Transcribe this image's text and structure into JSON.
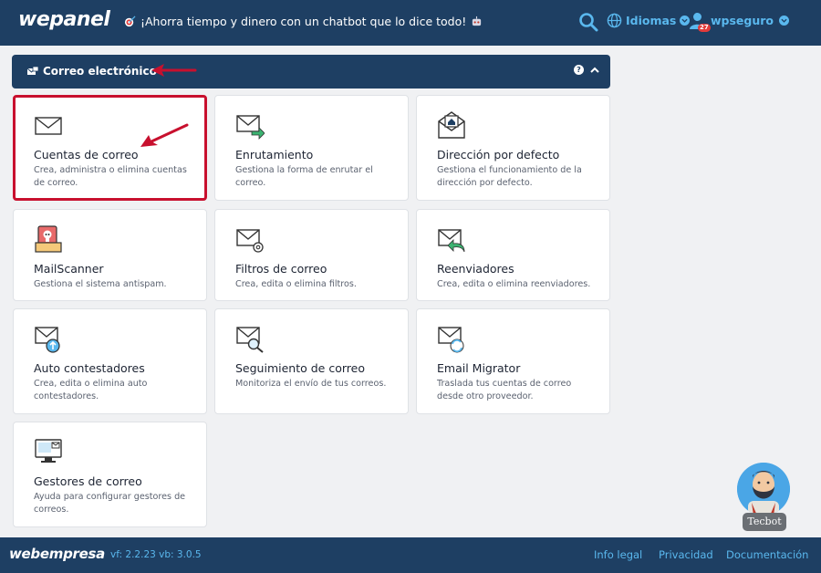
{
  "topbar": {
    "logo": "wepanel",
    "promo_text": "¡Ahorra tiempo y dinero con un chatbot que lo dice todo!",
    "languages_label": "Idiomas",
    "username": "wpseguro",
    "notification_count": "27"
  },
  "section": {
    "title": "Correo electrónico",
    "help_label": "?"
  },
  "cards": [
    {
      "title": "Cuentas de correo",
      "description": "Crea, administra o elimina cuentas de correo.",
      "icon": "mail-envelope-icon"
    },
    {
      "title": "Enrutamiento",
      "description": "Gestiona la forma de enrutar el correo.",
      "icon": "mail-routing-icon"
    },
    {
      "title": "Dirección por defecto",
      "description": "Gestiona el funcionamiento de la dirección por defecto.",
      "icon": "mail-default-address-icon"
    },
    {
      "title": "MailScanner",
      "description": "Gestiona el sistema antispam.",
      "icon": "mailscanner-icon"
    },
    {
      "title": "Filtros de correo",
      "description": "Crea, edita o elimina filtros.",
      "icon": "mail-filter-icon"
    },
    {
      "title": "Reenviadores",
      "description": "Crea, edita o elimina reenviadores.",
      "icon": "mail-forwarder-icon"
    },
    {
      "title": "Auto contestadores",
      "description": "Crea, edita o elimina auto contestadores.",
      "icon": "mail-autoresponder-icon"
    },
    {
      "title": "Seguimiento de correo",
      "description": "Monitoriza el envío de tus correos.",
      "icon": "mail-tracking-icon"
    },
    {
      "title": "Email Migrator",
      "description": "Traslada tus cuentas de correo desde otro proveedor.",
      "icon": "mail-migrator-icon"
    },
    {
      "title": "Gestores de correo",
      "description": "Ayuda para configurar gestores de correos.",
      "icon": "mail-client-icon"
    }
  ],
  "footer": {
    "logo": "webempresa",
    "version": "vf: 2.2.23 vb: 3.0.5",
    "links": [
      "Info legal",
      "Privacidad",
      "Documentación"
    ]
  },
  "tecbot": {
    "label": "Tecbot"
  },
  "colors": {
    "navy": "#1e3f63",
    "link_blue": "#5ab8ee",
    "highlight_red": "#c8102e",
    "background": "#f0f1f3"
  }
}
